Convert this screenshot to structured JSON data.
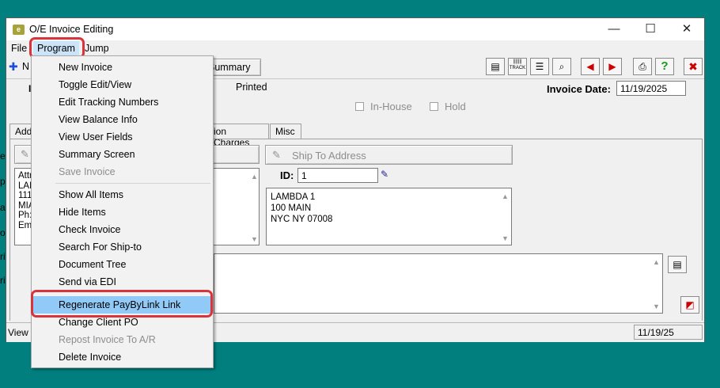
{
  "window": {
    "title": "O/E Invoice Editing",
    "minimize_glyph": "—",
    "maximize_glyph": "☐",
    "close_glyph": "✕"
  },
  "menubar": {
    "file": "File",
    "program": "Program",
    "jump": "Jump"
  },
  "toolbar": {
    "new_label": "N",
    "summary_label": "Summary",
    "track_label": "TRACK"
  },
  "header": {
    "printed": "Printed",
    "invoice_date_label": "Invoice Date:",
    "invoice_date_value": "11/19/2025",
    "in_house_label": "In-House",
    "hold_label": "Hold"
  },
  "tabs": {
    "addr_partial": "Add",
    "charges_partial": "ion Charges",
    "misc": "Misc"
  },
  "bill_to": {
    "lines": [
      "Attn",
      "LAM",
      "111",
      "MIA",
      "Ph:",
      "Em"
    ]
  },
  "ship_to": {
    "button_label": "Ship To Address",
    "id_label": "ID:",
    "id_value": "1",
    "address": [
      "LAMBDA 1",
      "100 MAIN",
      "NYC  NY    07008"
    ]
  },
  "left_edge_labels": [
    "e",
    "p",
    "a",
    "o",
    "ri",
    "ri"
  ],
  "status": {
    "left_partial": "View I",
    "date": "11/19/25"
  },
  "program_menu": {
    "group1": [
      {
        "label": "New Invoice",
        "enabled": true
      },
      {
        "label": "Toggle Edit/View",
        "enabled": true
      },
      {
        "label": "Edit Tracking Numbers",
        "enabled": true
      },
      {
        "label": "View Balance Info",
        "enabled": true
      },
      {
        "label": "View User Fields",
        "enabled": true
      },
      {
        "label": "Summary Screen",
        "enabled": true
      },
      {
        "label": "Save Invoice",
        "enabled": false
      }
    ],
    "group2": [
      {
        "label": "Show All Items",
        "enabled": true
      },
      {
        "label": "Hide Items",
        "enabled": true
      },
      {
        "label": "Check Invoice",
        "enabled": true
      },
      {
        "label": "Search For Ship-to",
        "enabled": true
      },
      {
        "label": "Document Tree",
        "enabled": true
      },
      {
        "label": "Send via EDI",
        "enabled": true
      }
    ],
    "group3": [
      {
        "label": "Regenerate PayByLink Link",
        "enabled": true,
        "highlighted": true
      },
      {
        "label": "Change Client PO",
        "enabled": true
      },
      {
        "label": "Repost Invoice To A/R",
        "enabled": false
      },
      {
        "label": "Delete Invoice",
        "enabled": true
      }
    ]
  },
  "colors": {
    "desktop": "#007f7f",
    "highlight": "#91c9f7",
    "annotation_red": "#d9343b"
  }
}
